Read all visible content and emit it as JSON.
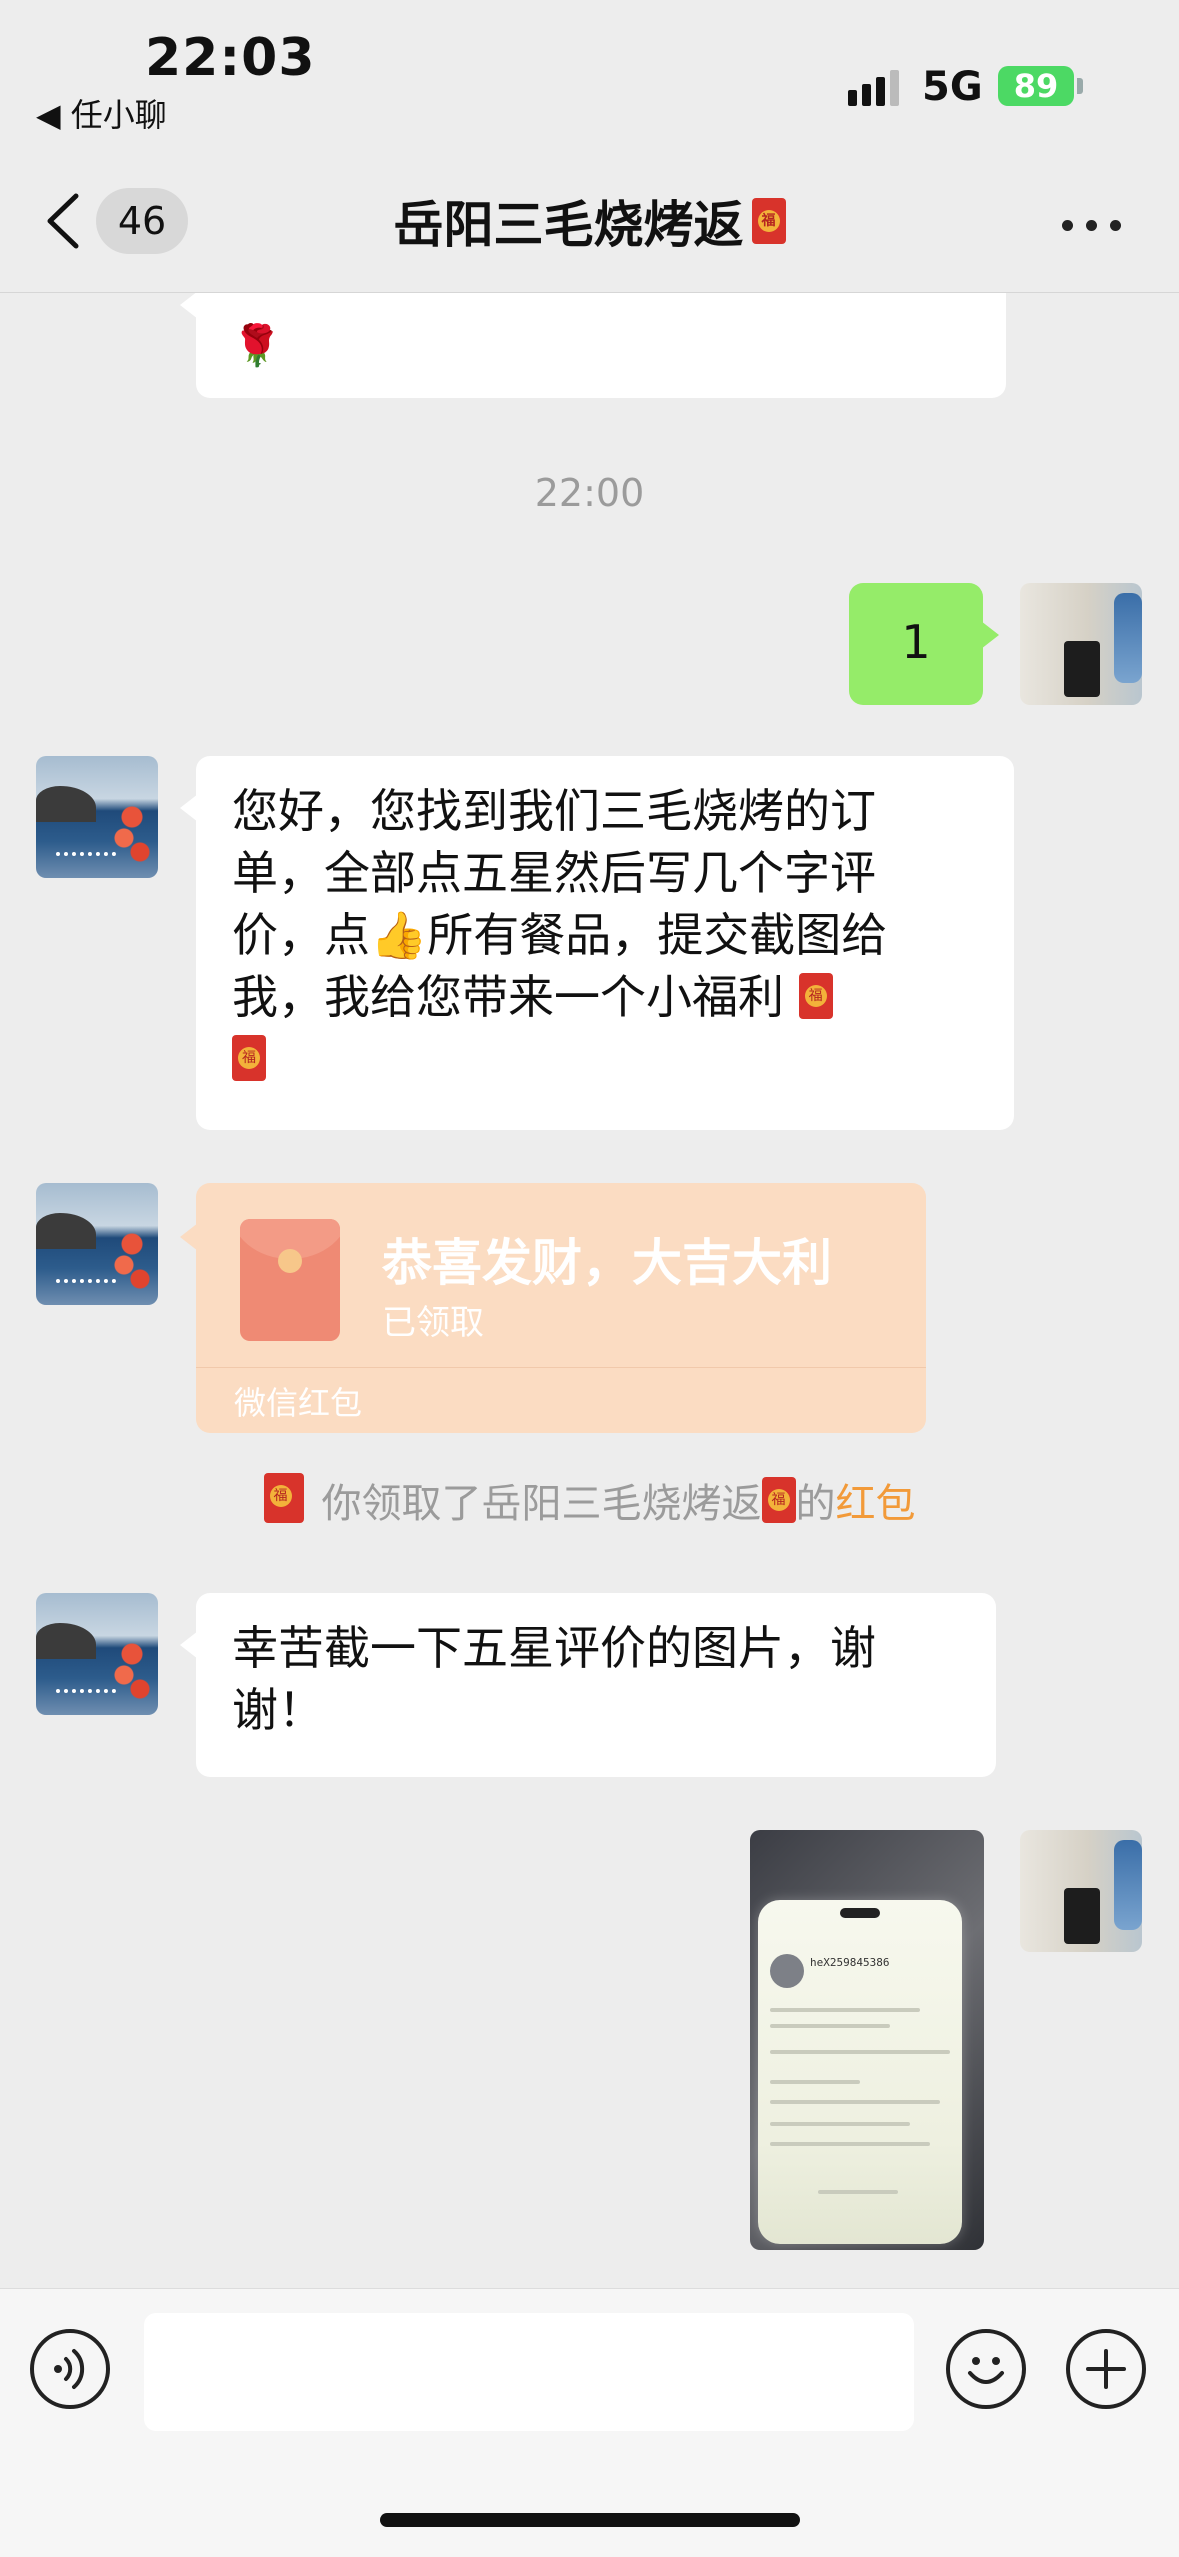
{
  "status_bar": {
    "time": "22:03",
    "back_app": "◀ 任小聊",
    "network": "5G",
    "battery": "89"
  },
  "nav": {
    "unread_count": "46",
    "title": "岳阳三毛烧烤返"
  },
  "messages": {
    "top_partial_text": "",
    "timestamp": "22:00",
    "sent_1": "1",
    "received_1_line1": "您好，您找到我们三毛烧烤的订",
    "received_1_line2": "单，全部点五星然后写几个字评",
    "received_1_line3a": "价，点",
    "received_1_emoji": "👍",
    "received_1_line3b": "所有餐品，提交截图给",
    "received_1_line4": "我，我给您带来一个小福利",
    "red_packet": {
      "title": "恭喜发财，大吉大利",
      "status": "已领取",
      "footer": "微信红包"
    },
    "system": {
      "prefix": "你领取了岳阳三毛烧烤返",
      "middle": "的",
      "link": "红包"
    },
    "received_2_line1": "幸苦截一下五星评价的图片，谢",
    "received_2_line2": "谢！",
    "screenshot_username": "heX259845386"
  },
  "input": {
    "placeholder": ""
  },
  "colors": {
    "bubble_sent": "#95ec69",
    "red_packet": "#fbdcc2",
    "link": "#f29a39"
  }
}
